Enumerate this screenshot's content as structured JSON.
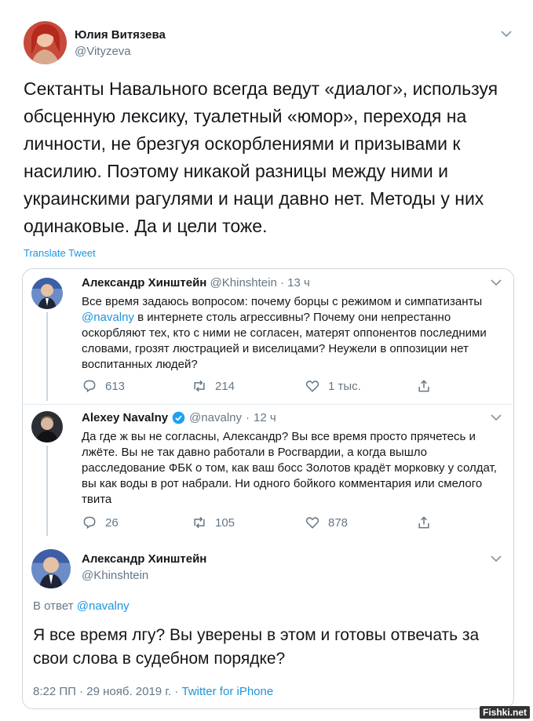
{
  "main_tweet": {
    "author_name": "Юлия Витязева",
    "author_handle": "@Vityzeva",
    "text": "Сектанты Навального всегда ведут «диалог», используя обсценную лексику, туалетный «юмор», переходя на личности, не брезгуя оскорблениями и призывами к насилию. Поэтому никакой разницы между ними и украинскими рагулями и наци давно нет. Методы у них одинаковые. Да и цели тоже.",
    "translate_label": "Translate Tweet"
  },
  "quoted_thread": {
    "first": {
      "author_name": "Александр Хинштейн",
      "author_handle": "@Khinshtein",
      "separator": "·",
      "time": "13 ч",
      "text_before_mention": "Все время задаюсь вопросом: почему борцы с режимом и симпатизанты ",
      "mention": "@navalny",
      "text_after_mention": " в интернете столь агрессивны? Почему они непрестанно оскорбляют тех, кто с ними не согласен, матерят оппонентов последними словами, грозят люстрацией и виселицами? Неужели в оппозиции нет воспитанных людей?",
      "replies": "613",
      "retweets": "214",
      "likes": "1 тыс."
    },
    "second": {
      "author_name": "Alexey Navalny",
      "author_handle": "@navalny",
      "separator": "·",
      "time": "12 ч",
      "text": "Да где ж вы не согласны, Александр? Вы все время просто прячетесь и лжёте. Вы не так давно работали в Росгвардии, а когда вышло расследование ФБК о том, как ваш босс Золотов крадёт морковку у солдат, вы как воды в рот набрали. Ни одного бойкого комментария или смелого твита",
      "replies": "26",
      "retweets": "105",
      "likes": "878"
    },
    "third": {
      "author_name": "Александр Хинштейн",
      "author_handle": "@Khinshtein",
      "reply_prefix": "В ответ ",
      "reply_mention": "@navalny",
      "text": "Я все время лгу? Вы уверены в этом и готовы отвечать за свои слова в судебном порядке?",
      "timestamp": "8:22 ПП · 29 нояб. 2019 г. · ",
      "source": "Twitter for iPhone"
    }
  },
  "watermark": "Fishki.net",
  "colors": {
    "link": "#1b95e0",
    "secondary_text": "#657786",
    "verified": "#1da1f2",
    "border": "#ccd6dd"
  }
}
